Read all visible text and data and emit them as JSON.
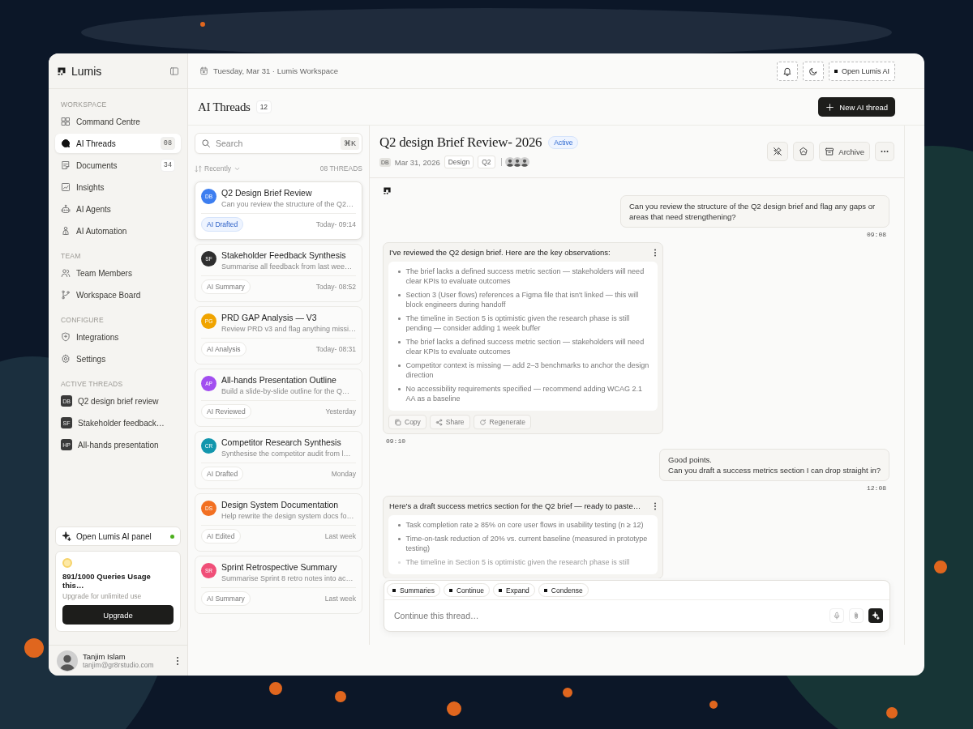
{
  "app": {
    "name": "Lumis"
  },
  "sidebar": {
    "sections": [
      {
        "heading": "WORKSPACE",
        "items": [
          {
            "label": "Command Centre",
            "selected": false
          },
          {
            "label": "AI Threads",
            "count": "08",
            "selected": true
          },
          {
            "label": "Documents",
            "count": "34",
            "selected": false
          },
          {
            "label": "Insights",
            "selected": false
          },
          {
            "label": "AI Agents",
            "selected": false
          },
          {
            "label": "AI Automation",
            "selected": false
          }
        ]
      },
      {
        "heading": "TEAM",
        "items": [
          {
            "label": "Team Members",
            "selected": false
          },
          {
            "label": "Workspace Board",
            "selected": false
          }
        ]
      },
      {
        "heading": "CONFIGURE",
        "items": [
          {
            "label": "Integrations",
            "selected": false
          },
          {
            "label": "Settings",
            "selected": false
          }
        ]
      }
    ],
    "active_threads": {
      "heading": "ACTIVE THREADS",
      "items": [
        {
          "initials": "DB",
          "label": "Q2 design brief review"
        },
        {
          "initials": "SF",
          "label": "Stakeholder feedback…"
        },
        {
          "initials": "HP",
          "label": "All-hands presentation"
        }
      ]
    },
    "ai_panel": {
      "label": "Open Lumis AI panel",
      "online": true
    },
    "usage": {
      "title": "891/1000 Queries Usage this…",
      "note": "Upgrade for unlimited use",
      "button": "Upgrade"
    },
    "user": {
      "name": "Tanjim Islam",
      "email": "tanjim@gr8rstudio.com"
    }
  },
  "topbar": {
    "date": "Tuesday, Mar 31 · Lumis Workspace",
    "ai_button": "Open Lumis AI"
  },
  "threads_header": {
    "title": "AI Threads",
    "count": "12",
    "new_button": "New AI thread"
  },
  "thread_list": {
    "search": {
      "placeholder": "Search",
      "shortcut": "⌘K"
    },
    "sort": "Recently",
    "total": "08 THREADS",
    "threads": [
      {
        "initials": "DB",
        "color": "#3d7ef0",
        "title": "Q2 Design Brief Review",
        "preview": "Can you review the structure of the Q2…",
        "tag": "AI Drafted",
        "time": "Today- 09:14",
        "selected": true
      },
      {
        "initials": "SF",
        "color": "#2e2e2e",
        "title": "Stakeholder Feedback Synthesis",
        "preview": "Summarise all feedback from last wee…",
        "tag": "AI Summary",
        "time": "Today- 08:52",
        "selected": false
      },
      {
        "initials": "PG",
        "color": "#f0a400",
        "title": "PRD GAP Analysis — V3",
        "preview": "Review PRD v3 and flag anything missi…",
        "tag": "AI Analysis",
        "time": "Today- 08:31",
        "selected": false
      },
      {
        "initials": "AP",
        "color": "#a24ef0",
        "title": "All-hands Presentation Outline",
        "preview": "Build a slide-by-slide outline for the Q…",
        "tag": "AI Reviewed",
        "time": "Yesterday",
        "selected": false
      },
      {
        "initials": "CR",
        "color": "#1296ad",
        "title": "Competitor Research Synthesis",
        "preview": "Synthesise the competitor audit from l…",
        "tag": "AI Drafted",
        "time": "Monday",
        "selected": false
      },
      {
        "initials": "DS",
        "color": "#f27022",
        "title": "Design System Documentation",
        "preview": "Help rewrite the design system docs fo…",
        "tag": "AI Edited",
        "time": "Last week",
        "selected": false
      },
      {
        "initials": "SR",
        "color": "#f04f78",
        "title": "Sprint Retrospective Summary",
        "preview": "Summarise Sprint 8 retro notes into ac…",
        "tag": "AI Summary",
        "time": "Last week",
        "selected": false
      }
    ]
  },
  "chat": {
    "title": "Q2 design Brief Review- 2026",
    "status": "Active",
    "owner": "DB",
    "date": "Mar 31, 2026",
    "tags": [
      "Design",
      "Q2"
    ],
    "archive": "Archive",
    "messages": [
      {
        "kind": "user",
        "text": "Can you review the structure of the Q2 design brief and flag any gaps or areas that need strengthening?",
        "time": "09:08"
      },
      {
        "kind": "ai",
        "intro": "I've reviewed the Q2 design brief. Here are the key observations:",
        "points": [
          {
            "text": "The brief lacks a defined success metric section — stakeholders will need clear KPIs to evaluate outcomes",
            "faded": false
          },
          {
            "text": "Section 3 (User flows) references a Figma file that isn't linked — this will block engineers during handoff",
            "faded": false
          },
          {
            "text": "The timeline in Section 5 is optimistic given the research phase is still pending — consider adding 1 week buffer",
            "faded": false
          },
          {
            "text": "The brief lacks a defined success metric section — stakeholders will need clear KPIs to evaluate outcomes",
            "faded": false
          },
          {
            "text": "Competitor context is missing — add 2–3 benchmarks to anchor the design direction",
            "faded": false
          },
          {
            "text": "No accessibility requirements specified — recommend adding WCAG 2.1 AA as a baseline",
            "faded": false
          }
        ],
        "actions": [
          "Copy",
          "Share",
          "Regenerate"
        ],
        "time": "09:10"
      },
      {
        "kind": "user",
        "text": "Good points.\nCan you draft a success metrics section I can drop straight in?",
        "time": "12:08"
      },
      {
        "kind": "ai",
        "intro": "Here's a draft success metrics section for the Q2 brief — ready to paste…",
        "points": [
          {
            "text": "Task completion rate ≥ 85% on core user flows in usability testing (n ≥ 12)",
            "faded": false
          },
          {
            "text": "Time-on-task reduction of 20% vs. current baseline (measured in prototype testing)",
            "faded": false
          },
          {
            "text": "The timeline in Section 5 is optimistic given the research phase is still",
            "faded": true
          }
        ]
      }
    ]
  },
  "composer": {
    "chips": [
      "Summaries",
      "Continue",
      "Expand",
      "Condense"
    ],
    "placeholder": "Continue this thread…"
  }
}
